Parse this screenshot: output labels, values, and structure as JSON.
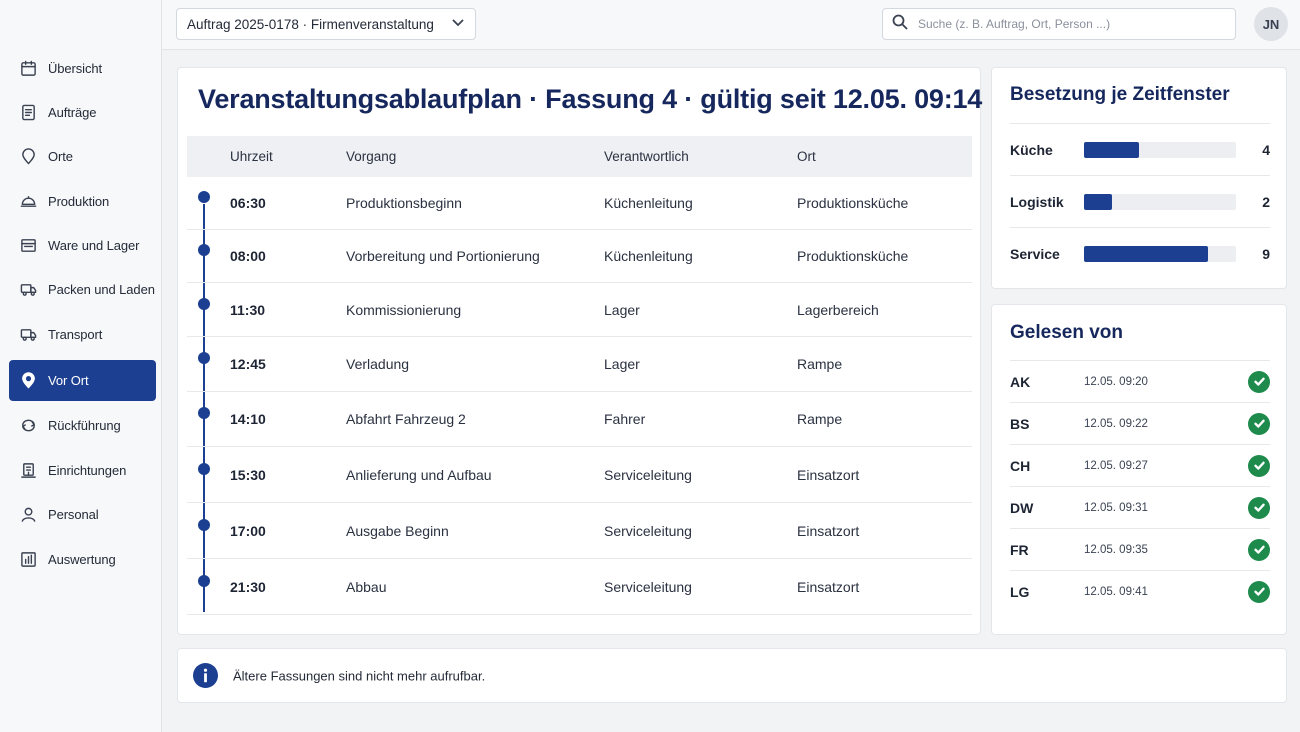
{
  "topbar": {
    "order_select_value": "Auftrag 2025-0178 · Firmenveranstaltung",
    "search_placeholder": "Suche (z. B. Auftrag, Ort, Person ...)",
    "avatar_initials": "JN"
  },
  "sidebar": {
    "active": "Vor Ort",
    "items": [
      {
        "label": "Übersicht",
        "icon": "calendar-icon"
      },
      {
        "label": "Aufträge",
        "icon": "document-icon"
      },
      {
        "label": "Orte",
        "icon": "map-pin-icon"
      },
      {
        "label": "Produktion",
        "icon": "cloche-icon"
      },
      {
        "label": "Ware und Lager",
        "icon": "inventory-icon"
      },
      {
        "label": "Packen und Laden",
        "icon": "truck-icon"
      },
      {
        "label": "Transport",
        "icon": "truck-icon"
      },
      {
        "label": "Vor Ort",
        "icon": "location-pin-icon"
      },
      {
        "label": "Rückführung",
        "icon": "return-icon"
      },
      {
        "label": "Einrichtungen",
        "icon": "building-icon"
      },
      {
        "label": "Personal",
        "icon": "people-icon"
      },
      {
        "label": "Auswertung",
        "icon": "bar-chart-icon"
      }
    ]
  },
  "plan": {
    "title": "Veranstaltungsablaufplan · Fassung 4 · gültig seit 12.05. 09:14",
    "columns": [
      "Uhrzeit",
      "Vorgang",
      "Verantwortlich",
      "Ort"
    ],
    "rows": [
      {
        "time": "06:30",
        "step": "Produktionsbeginn",
        "owner": "Küchenleitung",
        "place": "Produktionsküche"
      },
      {
        "time": "08:00",
        "step": "Vorbereitung und Portionierung",
        "owner": "Küchenleitung",
        "place": "Produktionsküche"
      },
      {
        "time": "11:30",
        "step": "Kommissionierung",
        "owner": "Lager",
        "place": "Lagerbereich"
      },
      {
        "time": "12:45",
        "step": "Verladung",
        "owner": "Lager",
        "place": "Rampe"
      },
      {
        "time": "14:10",
        "step": "Abfahrt Fahrzeug 2",
        "owner": "Fahrer",
        "place": "Rampe"
      },
      {
        "time": "15:30",
        "step": "Anlieferung und Aufbau",
        "owner": "Serviceleitung",
        "place": "Einsatzort"
      },
      {
        "time": "17:00",
        "step": "Ausgabe Beginn",
        "owner": "Serviceleitung",
        "place": "Einsatzort"
      },
      {
        "time": "21:30",
        "step": "Abbau",
        "owner": "Serviceleitung",
        "place": "Einsatzort"
      }
    ]
  },
  "occupancy": {
    "title": "Besetzung je Zeitfenster",
    "scale_max": 11,
    "rows": [
      {
        "name": "Küche",
        "count": 4
      },
      {
        "name": "Logistik",
        "count": 2
      },
      {
        "name": "Service",
        "count": 9
      }
    ]
  },
  "read_by": {
    "title": "Gelesen von",
    "rows": [
      {
        "initials": "AK",
        "time": "12.05. 09:20"
      },
      {
        "initials": "BS",
        "time": "12.05. 09:22"
      },
      {
        "initials": "CH",
        "time": "12.05. 09:27"
      },
      {
        "initials": "DW",
        "time": "12.05. 09:31"
      },
      {
        "initials": "FR",
        "time": "12.05. 09:35"
      },
      {
        "initials": "LG",
        "time": "12.05. 09:41"
      }
    ]
  },
  "notice": {
    "icon": "info-icon",
    "text": "Ältere Fassungen sind nicht mehr aufrufbar."
  },
  "colors": {
    "accent": "#1c3f91",
    "title": "#15275c",
    "success": "#1e8a4c"
  }
}
